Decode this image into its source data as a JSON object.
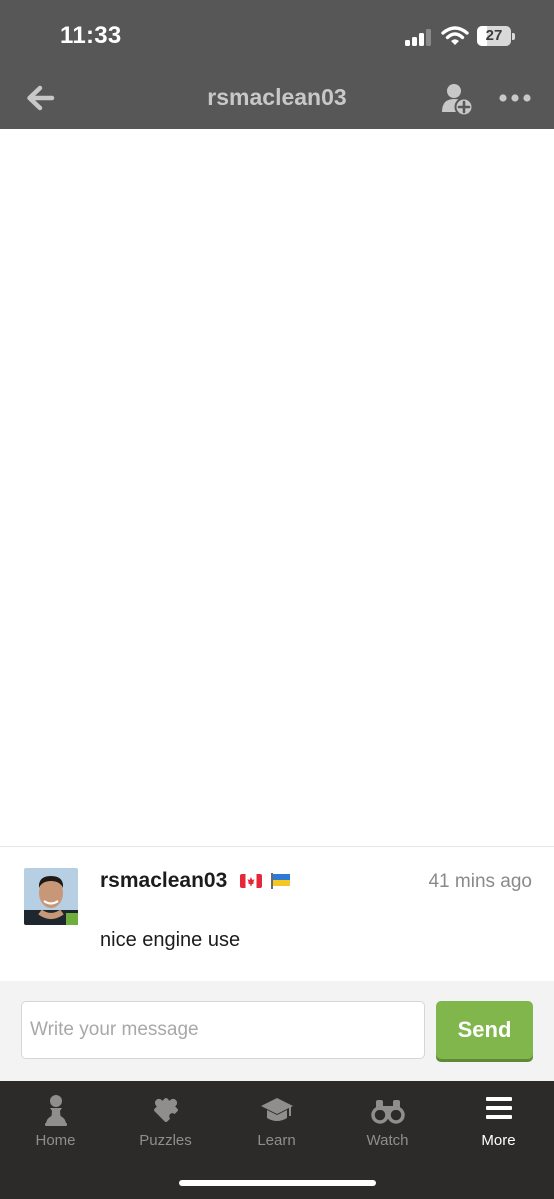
{
  "status_bar": {
    "time": "11:33",
    "battery_level": "27"
  },
  "header": {
    "title": "rsmaclean03",
    "icons": [
      "back-arrow-icon",
      "add-friend-icon",
      "more-dots-icon"
    ]
  },
  "message": {
    "username": "rsmaclean03",
    "flags": [
      "canada-flag-icon",
      "ukraine-flag-icon"
    ],
    "time_ago": "41 mins ago",
    "text": "nice engine use"
  },
  "composer": {
    "placeholder": "Write your message",
    "send_label": "Send"
  },
  "tabs": [
    {
      "label": "Home",
      "icon": "pawn-icon"
    },
    {
      "label": "Puzzles",
      "icon": "puzzle-icon"
    },
    {
      "label": "Learn",
      "icon": "graduation-cap-icon"
    },
    {
      "label": "Watch",
      "icon": "binoculars-icon"
    },
    {
      "label": "More",
      "icon": "menu-icon",
      "active": true
    }
  ],
  "colors": {
    "header_bg": "#575757",
    "accent_green": "#81b64c",
    "tabbar_bg": "#2c2b29"
  }
}
